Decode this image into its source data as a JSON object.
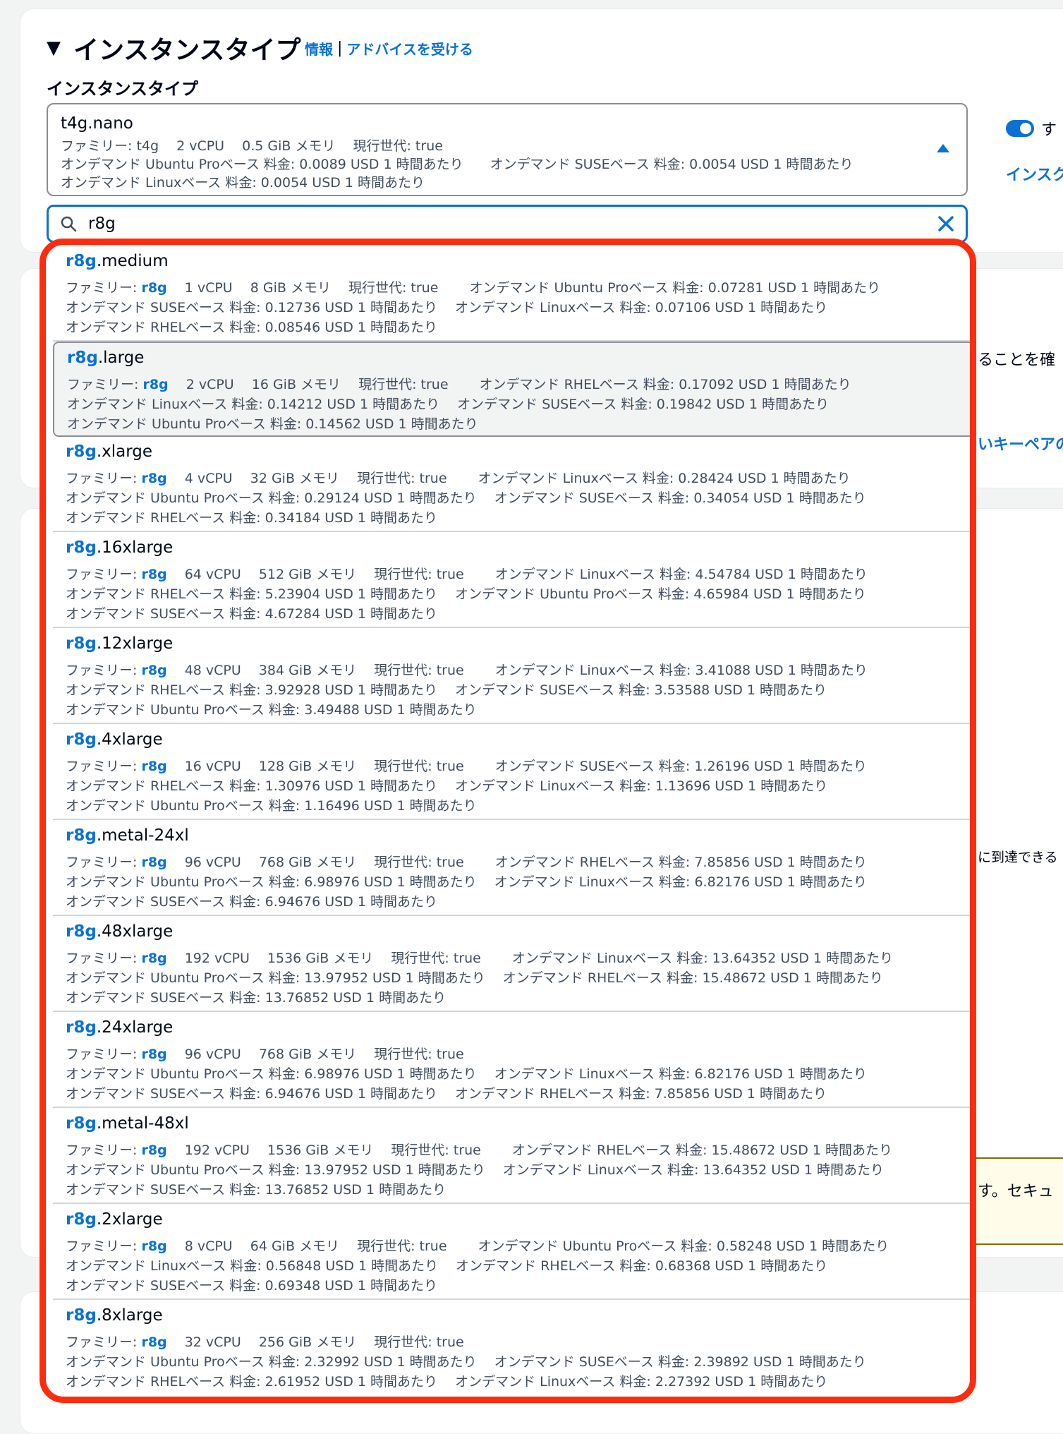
{
  "section": {
    "title": "インスタンスタイプ",
    "info_link": "情報",
    "separator": "|",
    "advice_link": "アドバイスを受ける",
    "field_label": "インスタンスタイプ"
  },
  "selected": {
    "name": "t4g.nano",
    "line1": "ファミリー: t4g　 2 vCPU　 0.5 GiB メモリ　 現行世代: true",
    "line2": "オンデマンド Ubuntu Proベース 料金: 0.0089 USD 1 時間あたり　　オンデマンド SUSEベース 料金: 0.0054 USD 1 時間あたり",
    "line3": "オンデマンド Linuxベース 料金: 0.0054 USD 1 時間あたり"
  },
  "search": {
    "value": "r8g"
  },
  "background": {
    "toggle_text": "す",
    "side_link": "インスク",
    "text_confirm": "ることを確",
    "text_keypair": "いキーペアの",
    "text_reach": "に到達できる",
    "text_security": "す。セキュ"
  },
  "options": [
    {
      "prefix": "r8g",
      "suffix": ".medium",
      "fam_label": "ファミリー: ",
      "fam": "r8g",
      "line1_rest": "　 1 vCPU　 8 GiB メモリ　 現行世代: true　　 オンデマンド Ubuntu Proベース 料金: 0.07281 USD 1 時間あたり",
      "line2": "オンデマンド SUSEベース 料金: 0.12736 USD 1 時間あたり　 オンデマンド Linuxベース 料金: 0.07106 USD 1 時間あたり",
      "line3": "オンデマンド RHELベース 料金: 0.08546 USD 1 時間あたり"
    },
    {
      "prefix": "r8g",
      "suffix": ".large",
      "fam_label": "ファミリー: ",
      "fam": "r8g",
      "line1_rest": "　 2 vCPU　 16 GiB メモリ　 現行世代: true　　 オンデマンド RHELベース 料金: 0.17092 USD 1 時間あたり",
      "line2": "オンデマンド Linuxベース 料金: 0.14212 USD 1 時間あたり　 オンデマンド SUSEベース 料金: 0.19842 USD 1 時間あたり",
      "line3": "オンデマンド Ubuntu Proベース 料金: 0.14562 USD 1 時間あたり"
    },
    {
      "prefix": "r8g",
      "suffix": ".xlarge",
      "fam_label": "ファミリー: ",
      "fam": "r8g",
      "line1_rest": "　 4 vCPU　 32 GiB メモリ　 現行世代: true　　 オンデマンド Linuxベース 料金: 0.28424 USD 1 時間あたり",
      "line2": "オンデマンド Ubuntu Proベース 料金: 0.29124 USD 1 時間あたり　 オンデマンド SUSEベース 料金: 0.34054 USD 1 時間あたり",
      "line3": "オンデマンド RHELベース 料金: 0.34184 USD 1 時間あたり"
    },
    {
      "prefix": "r8g",
      "suffix": ".16xlarge",
      "fam_label": "ファミリー: ",
      "fam": "r8g",
      "line1_rest": "　 64 vCPU　 512 GiB メモリ　 現行世代: true　　 オンデマンド Linuxベース 料金: 4.54784 USD 1 時間あたり",
      "line2": "オンデマンド RHELベース 料金: 5.23904 USD 1 時間あたり　 オンデマンド Ubuntu Proベース 料金: 4.65984 USD 1 時間あたり",
      "line3": "オンデマンド SUSEベース 料金: 4.67284 USD 1 時間あたり"
    },
    {
      "prefix": "r8g",
      "suffix": ".12xlarge",
      "fam_label": "ファミリー: ",
      "fam": "r8g",
      "line1_rest": "　 48 vCPU　 384 GiB メモリ　 現行世代: true　　 オンデマンド Linuxベース 料金: 3.41088 USD 1 時間あたり",
      "line2": "オンデマンド RHELベース 料金: 3.92928 USD 1 時間あたり　 オンデマンド SUSEベース 料金: 3.53588 USD 1 時間あたり",
      "line3": "オンデマンド Ubuntu Proベース 料金: 3.49488 USD 1 時間あたり"
    },
    {
      "prefix": "r8g",
      "suffix": ".4xlarge",
      "fam_label": "ファミリー: ",
      "fam": "r8g",
      "line1_rest": "　 16 vCPU　 128 GiB メモリ　 現行世代: true　　 オンデマンド SUSEベース 料金: 1.26196 USD 1 時間あたり",
      "line2": "オンデマンド RHELベース 料金: 1.30976 USD 1 時間あたり　 オンデマンド Linuxベース 料金: 1.13696 USD 1 時間あたり",
      "line3": "オンデマンド Ubuntu Proベース 料金: 1.16496 USD 1 時間あたり"
    },
    {
      "prefix": "r8g",
      "suffix": ".metal-24xl",
      "fam_label": "ファミリー: ",
      "fam": "r8g",
      "line1_rest": "　 96 vCPU　 768 GiB メモリ　 現行世代: true　　 オンデマンド RHELベース 料金: 7.85856 USD 1 時間あたり",
      "line2": "オンデマンド Ubuntu Proベース 料金: 6.98976 USD 1 時間あたり　 オンデマンド Linuxベース 料金: 6.82176 USD 1 時間あたり",
      "line3": "オンデマンド SUSEベース 料金: 6.94676 USD 1 時間あたり"
    },
    {
      "prefix": "r8g",
      "suffix": ".48xlarge",
      "fam_label": "ファミリー: ",
      "fam": "r8g",
      "line1_rest": "　 192 vCPU　 1536 GiB メモリ　 現行世代: true　　 オンデマンド Linuxベース 料金: 13.64352 USD 1 時間あたり",
      "line2": "オンデマンド Ubuntu Proベース 料金: 13.97952 USD 1 時間あたり　 オンデマンド RHELベース 料金: 15.48672 USD 1 時間あたり",
      "line3": "オンデマンド SUSEベース 料金: 13.76852 USD 1 時間あたり"
    },
    {
      "prefix": "r8g",
      "suffix": ".24xlarge",
      "fam_label": "ファミリー: ",
      "fam": "r8g",
      "line1_rest": "　 96 vCPU　 768 GiB メモリ　 現行世代: true",
      "line2": "オンデマンド Ubuntu Proベース 料金: 6.98976 USD 1 時間あたり　 オンデマンド Linuxベース 料金: 6.82176 USD 1 時間あたり",
      "line3": "オンデマンド SUSEベース 料金: 6.94676 USD 1 時間あたり　 オンデマンド RHELベース 料金: 7.85856 USD 1 時間あたり"
    },
    {
      "prefix": "r8g",
      "suffix": ".metal-48xl",
      "fam_label": "ファミリー: ",
      "fam": "r8g",
      "line1_rest": "　 192 vCPU　 1536 GiB メモリ　 現行世代: true　　 オンデマンド RHELベース 料金: 15.48672 USD 1 時間あたり",
      "line2": "オンデマンド Ubuntu Proベース 料金: 13.97952 USD 1 時間あたり　 オンデマンド Linuxベース 料金: 13.64352 USD 1 時間あたり",
      "line3": "オンデマンド SUSEベース 料金: 13.76852 USD 1 時間あたり"
    },
    {
      "prefix": "r8g",
      "suffix": ".2xlarge",
      "fam_label": "ファミリー: ",
      "fam": "r8g",
      "line1_rest": "　 8 vCPU　 64 GiB メモリ　 現行世代: true　　 オンデマンド Ubuntu Proベース 料金: 0.58248 USD 1 時間あたり",
      "line2": "オンデマンド Linuxベース 料金: 0.56848 USD 1 時間あたり　 オンデマンド RHELベース 料金: 0.68368 USD 1 時間あたり",
      "line3": "オンデマンド SUSEベース 料金: 0.69348 USD 1 時間あたり"
    },
    {
      "prefix": "r8g",
      "suffix": ".8xlarge",
      "fam_label": "ファミリー: ",
      "fam": "r8g",
      "line1_rest": "　 32 vCPU　 256 GiB メモリ　 現行世代: true",
      "line2": "オンデマンド Ubuntu Proベース 料金: 2.32992 USD 1 時間あたり　 オンデマンド SUSEベース 料金: 2.39892 USD 1 時間あたり",
      "line3": "オンデマンド RHELベース 料金: 2.61952 USD 1 時間あたり　 オンデマンド Linuxベース 料金: 2.27392 USD 1 時間あたり"
    }
  ]
}
